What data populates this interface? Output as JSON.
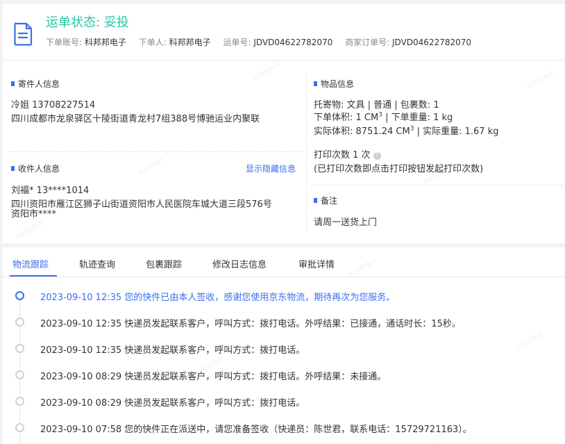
{
  "header": {
    "status_label": "运单状态: 妥投",
    "order_account_label": "下单账号:",
    "order_account_value": "科邦邦电子",
    "orderer_label": "下单人:",
    "orderer_value": "科邦邦电子",
    "waybill_label": "运单号:",
    "waybill_value": "JDVD04622782070",
    "merchant_order_label": "商家订单号:",
    "merchant_order_value": "JDVD04622782070",
    "icon": "document-icon"
  },
  "sender": {
    "section_title": "寄件人信息",
    "name_phone": "冷姐    13708227514",
    "address": "四川成都市龙泉驿区十陵街道青龙村7组388号博驰运业内聚联"
  },
  "receiver": {
    "section_title": "收件人信息",
    "show_hidden_link": "显示隐藏信息",
    "name_phone": "刘福*    13****1014",
    "address_line1": "四川资阳市雁江区狮子山街道资阳市人民医院车城大道三段576号",
    "address_line2": "资阳市****"
  },
  "goods": {
    "section_title": "物品信息",
    "consignment": "托寄物:  文具 | 普通  | 包裹数:  1",
    "order_volume_label": "下单体积:",
    "order_volume_value": "1 CM",
    "order_weight": " | 下单重量:  1 kg",
    "actual_volume_label": "实际体积:",
    "actual_volume_value": "8751.24 CM",
    "actual_weight": " | 实际重量:  1.67 kg",
    "cube_exp": "3",
    "print_count": "打印次数   1 次",
    "print_note": "(已打印次数即点击打印按钮发起打印次数)"
  },
  "remark": {
    "section_title": "备注",
    "content": "请周一送货上门"
  },
  "tabs": [
    {
      "label": "物流跟踪",
      "active": true
    },
    {
      "label": "轨迹查询"
    },
    {
      "label": "包裹跟踪"
    },
    {
      "label": "修改日志信息"
    },
    {
      "label": "审批详情"
    }
  ],
  "timeline": [
    {
      "time": "2023-09-10 12:35",
      "text": "您的快件已由本人签收，感谢您使用京东物流，期待再次为您服务。",
      "active": true
    },
    {
      "time": "2023-09-10 12:35",
      "text": "快递员发起联系客户，呼叫方式：拨打电话。外呼结果：已接通，通话时长：15秒。"
    },
    {
      "time": "2023-09-10 12:35",
      "text": "快递员发起联系客户，呼叫方式：拨打电话。"
    },
    {
      "time": "2023-09-10 08:29",
      "text": "快递员发起联系客户，呼叫方式：拨打电话。外呼结果：未接通。"
    },
    {
      "time": "2023-09-10 08:29",
      "text": "快递员发起联系客户，呼叫方式：拨打电话。"
    },
    {
      "time": "2023-09-10 07:58",
      "text": "您的快件正在派送中，请您准备签收（快递员：陈世君，联系电话：15729721163）。"
    }
  ],
  "watermark_text": "科邦邦电子",
  "colors": {
    "accent": "#3a6ef0",
    "status": "#26c6a6"
  }
}
